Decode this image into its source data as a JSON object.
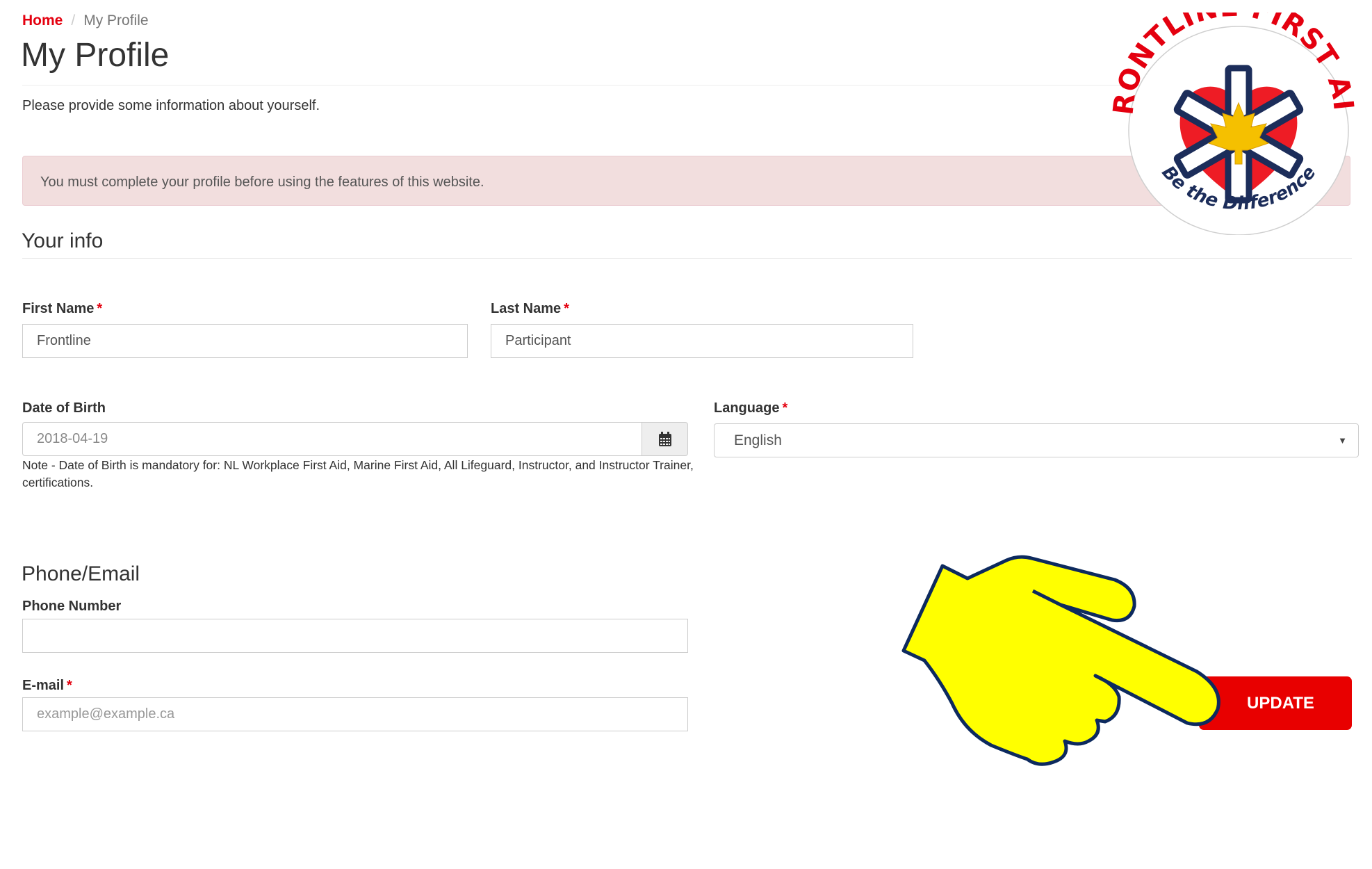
{
  "breadcrumb": {
    "home": "Home",
    "separator": "/",
    "current": "My Profile"
  },
  "page": {
    "title": "My Profile",
    "intro": "Please provide some information about yourself."
  },
  "alert": {
    "message": "You must complete your profile before using the features of this website.",
    "close_symbol": "×",
    "colors": {
      "background": "#f2dede",
      "border": "#ebccd1"
    }
  },
  "logo": {
    "top_text": "FRONTLINE FIRST AID",
    "bottom_text": "Be the Difference",
    "colors": {
      "text_red": "#e4000f",
      "navy": "#1c2d5a",
      "heart": "#ee1c25",
      "leaf": "#f5c000"
    }
  },
  "your_info": {
    "heading": "Your info",
    "first_name": {
      "label": "First Name",
      "required_mark": "*",
      "value": "Frontline"
    },
    "last_name": {
      "label": "Last Name",
      "required_mark": "*",
      "value": "Participant"
    },
    "date_of_birth": {
      "label": "Date of Birth",
      "value": "2018-04-19",
      "icon": "calendar-icon",
      "note": "Note - Date of Birth is mandatory for: NL Workplace First Aid, Marine First Aid, All Lifeguard, Instructor, and Instructor Trainer, certifications."
    },
    "language": {
      "label": "Language",
      "required_mark": "*",
      "selected": "English",
      "caret": "▼"
    }
  },
  "phone_email": {
    "heading": "Phone/Email",
    "phone": {
      "label": "Phone Number",
      "value": "",
      "placeholder": ""
    },
    "email": {
      "label": "E-mail",
      "required_mark": "*",
      "value": "",
      "placeholder": "example@example.ca"
    }
  },
  "actions": {
    "update_label": "UPDATE"
  },
  "colors": {
    "brand_red": "#e4000f",
    "button_red": "#e80000",
    "hand_fill": "#ffff00",
    "hand_outline": "#0d2a5e"
  }
}
